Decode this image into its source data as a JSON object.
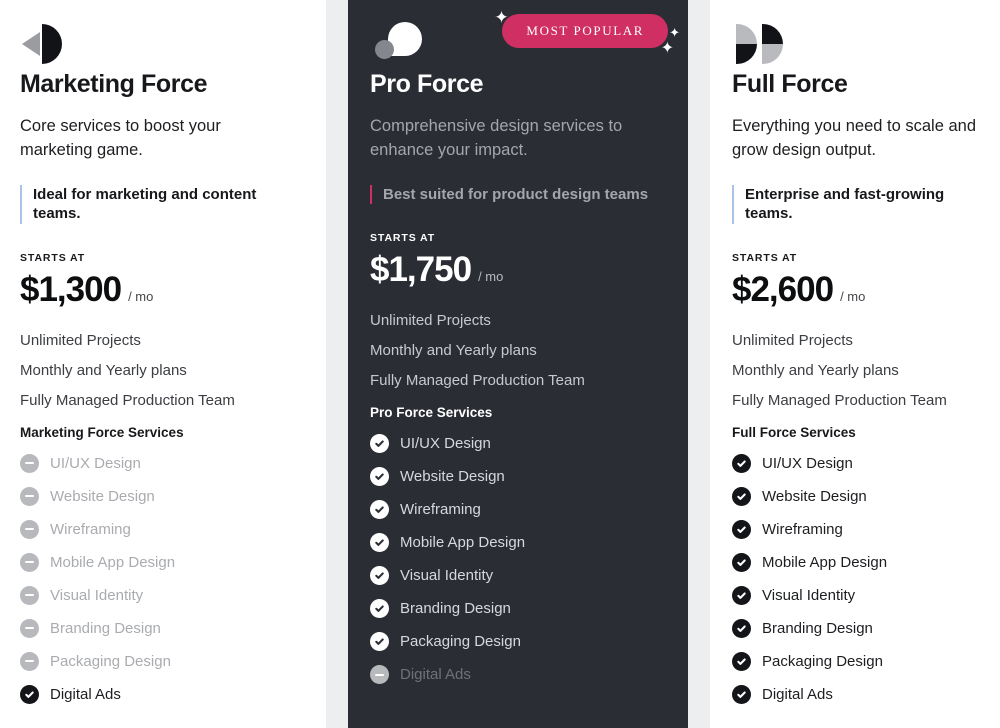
{
  "badge": {
    "label": "MOST POPULAR",
    "color": "#cf2f63",
    "sparkle_icon": "✦"
  },
  "labels": {
    "starts_at": "STARTS AT",
    "period": "/ mo"
  },
  "plans": [
    {
      "id": "marketing-force",
      "theme": "light",
      "logo": "marketing-force-logo",
      "title": "Marketing Force",
      "description": "Core services to boost your marketing game.",
      "tagline": "Ideal for marketing and content teams.",
      "starts_at": "STARTS AT",
      "price": "$1,300",
      "period": "/ mo",
      "perks": [
        "Unlimited Projects",
        "Monthly and Yearly plans",
        "Fully Managed Production Team"
      ],
      "services_title": "Marketing Force Services",
      "services": [
        {
          "label": "UI/UX Design",
          "included": false
        },
        {
          "label": "Website Design",
          "included": false
        },
        {
          "label": "Wireframing",
          "included": false
        },
        {
          "label": "Mobile App Design",
          "included": false
        },
        {
          "label": "Visual Identity",
          "included": false
        },
        {
          "label": "Branding Design",
          "included": false
        },
        {
          "label": "Packaging Design",
          "included": false
        },
        {
          "label": "Digital Ads",
          "included": true
        }
      ]
    },
    {
      "id": "pro-force",
      "theme": "dark",
      "logo": "pro-force-logo",
      "title": "Pro Force",
      "description": "Comprehensive design services to enhance your impact.",
      "tagline": "Best suited for product design teams",
      "starts_at": "STARTS AT",
      "price": "$1,750",
      "period": "/ mo",
      "perks": [
        "Unlimited Projects",
        "Monthly and Yearly plans",
        "Fully Managed Production Team"
      ],
      "services_title": "Pro Force Services",
      "services": [
        {
          "label": "UI/UX Design",
          "included": true
        },
        {
          "label": "Website Design",
          "included": true
        },
        {
          "label": "Wireframing",
          "included": true
        },
        {
          "label": "Mobile App Design",
          "included": true
        },
        {
          "label": "Visual Identity",
          "included": true
        },
        {
          "label": "Branding Design",
          "included": true
        },
        {
          "label": "Packaging Design",
          "included": true
        },
        {
          "label": "Digital Ads",
          "included": false
        }
      ]
    },
    {
      "id": "full-force",
      "theme": "light",
      "logo": "full-force-logo",
      "title": "Full Force",
      "description": "Everything you need to scale and grow design output.",
      "tagline": "Enterprise and fast-growing teams.",
      "starts_at": "STARTS AT",
      "price": "$2,600",
      "period": "/ mo",
      "perks": [
        "Unlimited Projects",
        "Monthly and Yearly plans",
        "Fully Managed Production Team"
      ],
      "services_title": "Full Force Services",
      "services": [
        {
          "label": "UI/UX Design",
          "included": true
        },
        {
          "label": "Website Design",
          "included": true
        },
        {
          "label": "Wireframing",
          "included": true
        },
        {
          "label": "Mobile App Design",
          "included": true
        },
        {
          "label": "Visual Identity",
          "included": true
        },
        {
          "label": "Branding Design",
          "included": true
        },
        {
          "label": "Packaging Design",
          "included": true
        },
        {
          "label": "Digital Ads",
          "included": true
        }
      ]
    }
  ]
}
